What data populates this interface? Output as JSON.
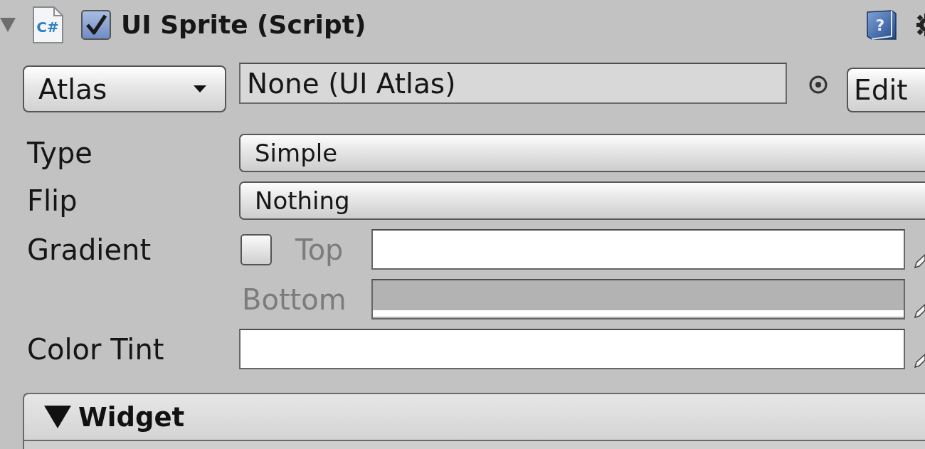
{
  "component": {
    "expanded": true,
    "enabled": true,
    "icon_label": "C#",
    "title": "UI Sprite (Script)",
    "help_glyph": "?"
  },
  "atlas": {
    "mode": "Atlas",
    "value": "None (UI Atlas)",
    "button": "Edit"
  },
  "fields": [
    {
      "kind": "popup",
      "label": "Type",
      "value": "Simple"
    },
    {
      "kind": "popup",
      "label": "Flip",
      "value": "Nothing"
    },
    {
      "kind": "gradient",
      "label": "Gradient",
      "checked": false,
      "stops": [
        {
          "label": "Top",
          "disabled": true,
          "color": "#ffffff"
        },
        {
          "label": "Bottom",
          "disabled": true,
          "color": "#b3b3b3"
        }
      ]
    },
    {
      "kind": "color",
      "label": "Color Tint",
      "color": "#ffffff"
    }
  ],
  "sections": [
    {
      "title": "Widget",
      "expanded": true
    }
  ]
}
